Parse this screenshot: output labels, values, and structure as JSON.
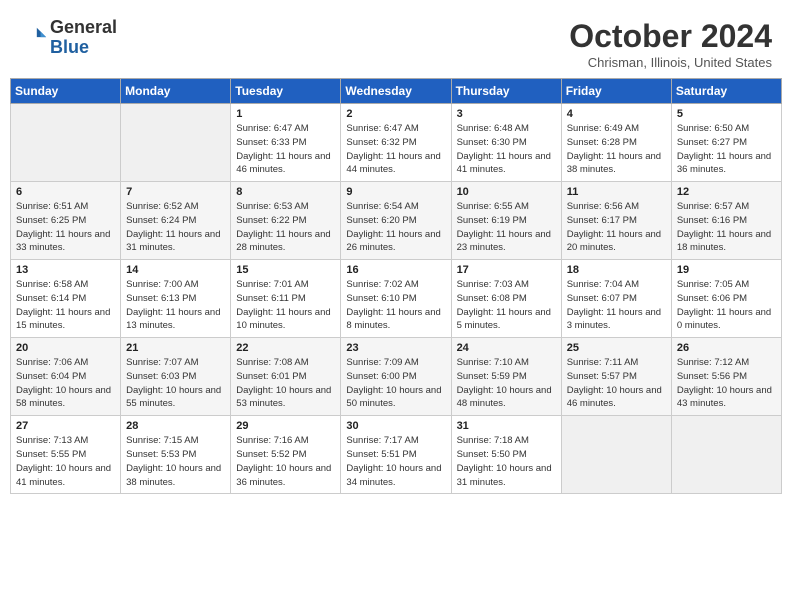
{
  "header": {
    "logo_general": "General",
    "logo_blue": "Blue",
    "month_title": "October 2024",
    "subtitle": "Chrisman, Illinois, United States"
  },
  "days_of_week": [
    "Sunday",
    "Monday",
    "Tuesday",
    "Wednesday",
    "Thursday",
    "Friday",
    "Saturday"
  ],
  "weeks": [
    [
      {
        "day": "",
        "sunrise": "",
        "sunset": "",
        "daylight": ""
      },
      {
        "day": "",
        "sunrise": "",
        "sunset": "",
        "daylight": ""
      },
      {
        "day": "1",
        "sunrise": "Sunrise: 6:47 AM",
        "sunset": "Sunset: 6:33 PM",
        "daylight": "Daylight: 11 hours and 46 minutes."
      },
      {
        "day": "2",
        "sunrise": "Sunrise: 6:47 AM",
        "sunset": "Sunset: 6:32 PM",
        "daylight": "Daylight: 11 hours and 44 minutes."
      },
      {
        "day": "3",
        "sunrise": "Sunrise: 6:48 AM",
        "sunset": "Sunset: 6:30 PM",
        "daylight": "Daylight: 11 hours and 41 minutes."
      },
      {
        "day": "4",
        "sunrise": "Sunrise: 6:49 AM",
        "sunset": "Sunset: 6:28 PM",
        "daylight": "Daylight: 11 hours and 38 minutes."
      },
      {
        "day": "5",
        "sunrise": "Sunrise: 6:50 AM",
        "sunset": "Sunset: 6:27 PM",
        "daylight": "Daylight: 11 hours and 36 minutes."
      }
    ],
    [
      {
        "day": "6",
        "sunrise": "Sunrise: 6:51 AM",
        "sunset": "Sunset: 6:25 PM",
        "daylight": "Daylight: 11 hours and 33 minutes."
      },
      {
        "day": "7",
        "sunrise": "Sunrise: 6:52 AM",
        "sunset": "Sunset: 6:24 PM",
        "daylight": "Daylight: 11 hours and 31 minutes."
      },
      {
        "day": "8",
        "sunrise": "Sunrise: 6:53 AM",
        "sunset": "Sunset: 6:22 PM",
        "daylight": "Daylight: 11 hours and 28 minutes."
      },
      {
        "day": "9",
        "sunrise": "Sunrise: 6:54 AM",
        "sunset": "Sunset: 6:20 PM",
        "daylight": "Daylight: 11 hours and 26 minutes."
      },
      {
        "day": "10",
        "sunrise": "Sunrise: 6:55 AM",
        "sunset": "Sunset: 6:19 PM",
        "daylight": "Daylight: 11 hours and 23 minutes."
      },
      {
        "day": "11",
        "sunrise": "Sunrise: 6:56 AM",
        "sunset": "Sunset: 6:17 PM",
        "daylight": "Daylight: 11 hours and 20 minutes."
      },
      {
        "day": "12",
        "sunrise": "Sunrise: 6:57 AM",
        "sunset": "Sunset: 6:16 PM",
        "daylight": "Daylight: 11 hours and 18 minutes."
      }
    ],
    [
      {
        "day": "13",
        "sunrise": "Sunrise: 6:58 AM",
        "sunset": "Sunset: 6:14 PM",
        "daylight": "Daylight: 11 hours and 15 minutes."
      },
      {
        "day": "14",
        "sunrise": "Sunrise: 7:00 AM",
        "sunset": "Sunset: 6:13 PM",
        "daylight": "Daylight: 11 hours and 13 minutes."
      },
      {
        "day": "15",
        "sunrise": "Sunrise: 7:01 AM",
        "sunset": "Sunset: 6:11 PM",
        "daylight": "Daylight: 11 hours and 10 minutes."
      },
      {
        "day": "16",
        "sunrise": "Sunrise: 7:02 AM",
        "sunset": "Sunset: 6:10 PM",
        "daylight": "Daylight: 11 hours and 8 minutes."
      },
      {
        "day": "17",
        "sunrise": "Sunrise: 7:03 AM",
        "sunset": "Sunset: 6:08 PM",
        "daylight": "Daylight: 11 hours and 5 minutes."
      },
      {
        "day": "18",
        "sunrise": "Sunrise: 7:04 AM",
        "sunset": "Sunset: 6:07 PM",
        "daylight": "Daylight: 11 hours and 3 minutes."
      },
      {
        "day": "19",
        "sunrise": "Sunrise: 7:05 AM",
        "sunset": "Sunset: 6:06 PM",
        "daylight": "Daylight: 11 hours and 0 minutes."
      }
    ],
    [
      {
        "day": "20",
        "sunrise": "Sunrise: 7:06 AM",
        "sunset": "Sunset: 6:04 PM",
        "daylight": "Daylight: 10 hours and 58 minutes."
      },
      {
        "day": "21",
        "sunrise": "Sunrise: 7:07 AM",
        "sunset": "Sunset: 6:03 PM",
        "daylight": "Daylight: 10 hours and 55 minutes."
      },
      {
        "day": "22",
        "sunrise": "Sunrise: 7:08 AM",
        "sunset": "Sunset: 6:01 PM",
        "daylight": "Daylight: 10 hours and 53 minutes."
      },
      {
        "day": "23",
        "sunrise": "Sunrise: 7:09 AM",
        "sunset": "Sunset: 6:00 PM",
        "daylight": "Daylight: 10 hours and 50 minutes."
      },
      {
        "day": "24",
        "sunrise": "Sunrise: 7:10 AM",
        "sunset": "Sunset: 5:59 PM",
        "daylight": "Daylight: 10 hours and 48 minutes."
      },
      {
        "day": "25",
        "sunrise": "Sunrise: 7:11 AM",
        "sunset": "Sunset: 5:57 PM",
        "daylight": "Daylight: 10 hours and 46 minutes."
      },
      {
        "day": "26",
        "sunrise": "Sunrise: 7:12 AM",
        "sunset": "Sunset: 5:56 PM",
        "daylight": "Daylight: 10 hours and 43 minutes."
      }
    ],
    [
      {
        "day": "27",
        "sunrise": "Sunrise: 7:13 AM",
        "sunset": "Sunset: 5:55 PM",
        "daylight": "Daylight: 10 hours and 41 minutes."
      },
      {
        "day": "28",
        "sunrise": "Sunrise: 7:15 AM",
        "sunset": "Sunset: 5:53 PM",
        "daylight": "Daylight: 10 hours and 38 minutes."
      },
      {
        "day": "29",
        "sunrise": "Sunrise: 7:16 AM",
        "sunset": "Sunset: 5:52 PM",
        "daylight": "Daylight: 10 hours and 36 minutes."
      },
      {
        "day": "30",
        "sunrise": "Sunrise: 7:17 AM",
        "sunset": "Sunset: 5:51 PM",
        "daylight": "Daylight: 10 hours and 34 minutes."
      },
      {
        "day": "31",
        "sunrise": "Sunrise: 7:18 AM",
        "sunset": "Sunset: 5:50 PM",
        "daylight": "Daylight: 10 hours and 31 minutes."
      },
      {
        "day": "",
        "sunrise": "",
        "sunset": "",
        "daylight": ""
      },
      {
        "day": "",
        "sunrise": "",
        "sunset": "",
        "daylight": ""
      }
    ]
  ]
}
